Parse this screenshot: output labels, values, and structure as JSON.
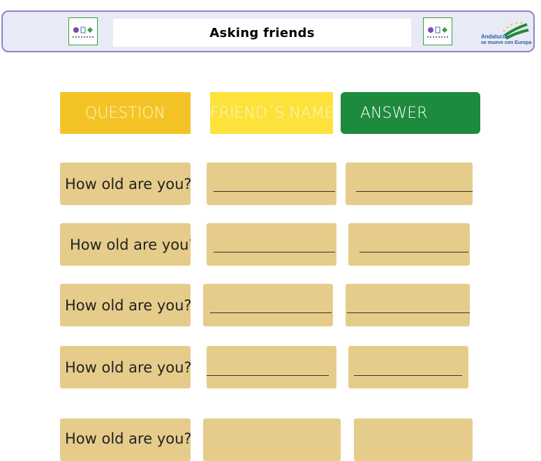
{
  "header": {
    "title": "Asking friends",
    "logo_icon": "school-logo-icon",
    "andalucia_line1": "Andalucía",
    "andalucia_line2": "se mueve con Europa"
  },
  "columns": {
    "question": "QUESTION",
    "friend_name": "FRIEND´S NAME",
    "answer": "ANSWER"
  },
  "rows": [
    {
      "question": "How old are you?"
    },
    {
      "question": "How old are you?"
    },
    {
      "question": "How old are you?"
    },
    {
      "question": "How old are you?"
    },
    {
      "question": "How old are you?"
    }
  ],
  "colors": {
    "question_header": "#f4c427",
    "name_header": "#fce23b",
    "answer_header": "#1e8a3d",
    "card": "#e6cc8a",
    "header_border": "#8f83c6"
  }
}
